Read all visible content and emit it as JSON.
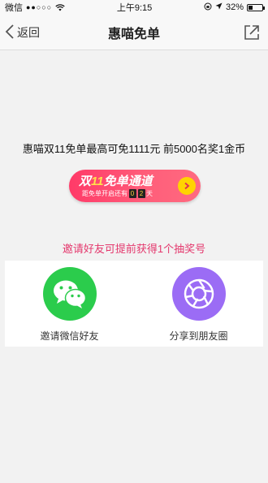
{
  "status_bar": {
    "carrier": "微信",
    "signal": "●●○○○",
    "time": "上午9:15",
    "battery_percent": "32%",
    "battery_level": 0.32
  },
  "nav": {
    "back_label": "返回",
    "title": "惠喵免单"
  },
  "headline": "惠喵双11免单最高可免1111元 前5000名奖1金币",
  "promo": {
    "title_prefix": "双",
    "title_number": "11",
    "title_suffix": "免单通道",
    "countdown_prefix": "距免单开启还有",
    "digit_1": "0",
    "digit_2": "2",
    "countdown_unit": "天"
  },
  "invite_tip": "邀请好友可提前获得1个抽奖号",
  "share_options": [
    {
      "label": "邀请微信好友",
      "icon": "wechat-icon",
      "color": "#2bcc4c"
    },
    {
      "label": "分享到朋友圈",
      "icon": "moments-icon",
      "color": "#9b6cf5"
    }
  ]
}
